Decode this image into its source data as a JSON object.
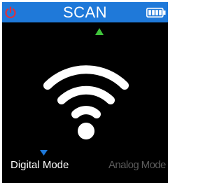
{
  "header": {
    "title": "SCAN",
    "left_icon": "power-icon",
    "right_icon": "battery-icon"
  },
  "main": {
    "indicator_icon": "up-arrow-icon",
    "status_icon": "wifi-signal-icon",
    "selection_indicator_icon": "down-arrow-icon"
  },
  "modes": [
    {
      "label": "Digital Mode",
      "selected": true
    },
    {
      "label": "Analog Mode",
      "selected": false
    }
  ],
  "colors": {
    "header_bg": "#1f79d9",
    "screen_bg": "#000000",
    "power_icon": "#e0313b",
    "indicator_green": "#3fc33b",
    "selection_blue": "#1f79d9",
    "active_text": "#ffffff",
    "inactive_text": "#5c5c5c"
  }
}
